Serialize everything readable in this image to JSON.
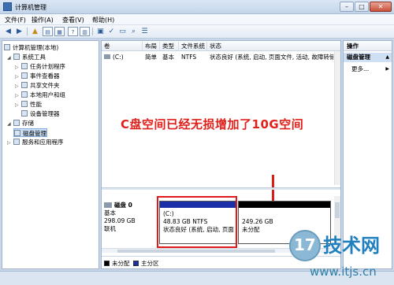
{
  "window": {
    "title": "计算机管理",
    "min": "–",
    "max": "□",
    "close": "✕"
  },
  "menu": [
    "文件(F)",
    "操作(A)",
    "查看(V)",
    "帮助(H)"
  ],
  "tree": {
    "root": "计算机管理(本地)",
    "system_tools": "系统工具",
    "task_scheduler": "任务计划程序",
    "event_viewer": "事件查看器",
    "shared_folders": "共享文件夹",
    "local_users": "本地用户和组",
    "performance": "性能",
    "device_manager": "设备管理器",
    "storage": "存储",
    "disk_management": "磁盘管理",
    "services": "服务和应用程序"
  },
  "volumes": {
    "headers": [
      "卷",
      "布局",
      "类型",
      "文件系统",
      "状态"
    ],
    "rows": [
      {
        "volume": "(C:)",
        "layout": "简单",
        "type": "基本",
        "fs": "NTFS",
        "status": "状态良好 (系统, 启动, 页面文件, 活动, 故障转储, 主分区"
      }
    ]
  },
  "annotation": "C盘空间已经无损增加了10G空间",
  "disk": {
    "name": "磁盘 0",
    "kind": "基本",
    "size": "298.09 GB",
    "state": "联机",
    "partitions": [
      {
        "title": "(C:)",
        "size": "48.83 GB NTFS",
        "status": "状态良好 (系统, 启动, 页面",
        "color": "#1b2fa8"
      },
      {
        "title": "",
        "size": "249.26 GB",
        "status": "未分配",
        "color": "#000000"
      }
    ]
  },
  "legend": [
    {
      "label": "未分配",
      "color": "#000000"
    },
    {
      "label": "主分区",
      "color": "#1b2fa8"
    }
  ],
  "actions": {
    "header": "操作",
    "selected": "磁盘管理",
    "more": "更多..."
  },
  "watermark": {
    "num": "17",
    "name": "技术网",
    "url": "www.itjs.cn"
  }
}
